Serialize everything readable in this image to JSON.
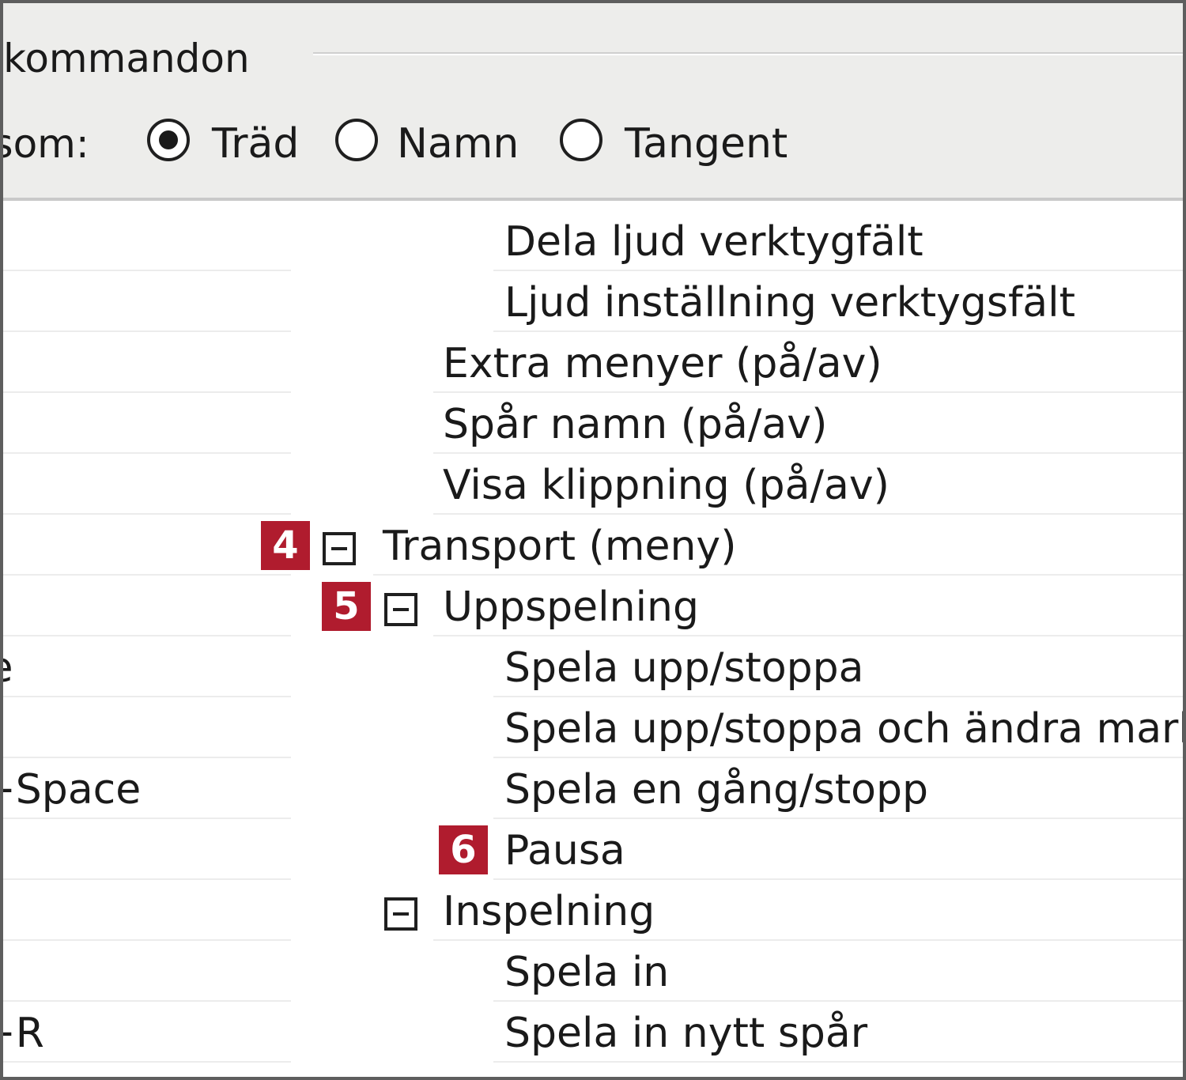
{
  "header": {
    "group_title": "rtkommandon",
    "view_label": "a som:",
    "view_options": [
      {
        "label": "Träd",
        "selected": true
      },
      {
        "label": "Namn",
        "selected": false
      },
      {
        "label": "Tangent",
        "selected": false
      }
    ]
  },
  "tree": {
    "rows": [
      {
        "key": "",
        "command": "Dela ljud verktygfält"
      },
      {
        "key": "",
        "command": "Ljud inställning verktygsfält"
      },
      {
        "key": "",
        "command": "Extra menyer (på/av)"
      },
      {
        "key": "",
        "command": "Spår namn (på/av)"
      },
      {
        "key": "",
        "command": "Visa klippning (på/av)"
      },
      {
        "key": "",
        "command": "Transport (meny)",
        "badge": "4",
        "expanded": true
      },
      {
        "key": "",
        "command": "Uppspelning",
        "badge": "5",
        "expanded": true
      },
      {
        "key": "ace",
        "command": "Spela upp/stoppa"
      },
      {
        "key": "",
        "command": "Spela upp/stoppa och ändra mark"
      },
      {
        "key": "ift+Space",
        "command": "Spela en gång/stopp"
      },
      {
        "key": "",
        "command": "Pausa",
        "badge": "6"
      },
      {
        "key": "",
        "command": "Inspelning",
        "expanded": true
      },
      {
        "key": "",
        "command": "Spela in"
      },
      {
        "key": "ift+R",
        "command": "Spela in nytt spår"
      }
    ]
  },
  "colors": {
    "badge": "#b01c2e",
    "header_bg": "#ededeb"
  }
}
